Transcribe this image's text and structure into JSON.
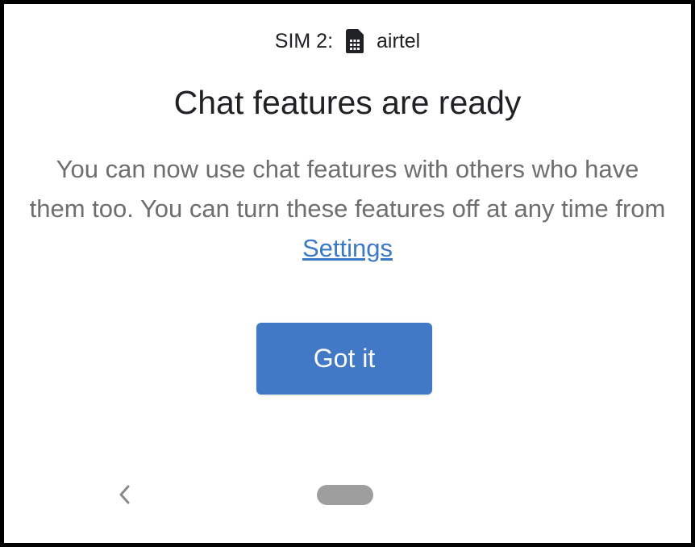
{
  "status": {
    "sim_label": "SIM 2:",
    "sim_icon": "sim-card-icon",
    "carrier": "airtel"
  },
  "dialog": {
    "title": "Chat features are ready",
    "body_text": "You can now use chat features with others who have them too. You can turn these features off at any time from ",
    "settings_link": "Settings",
    "button_label": "Got it"
  },
  "nav": {
    "back_icon": "back-chevron-icon",
    "home_icon": "home-pill-icon"
  },
  "colors": {
    "button": "#4179c7",
    "link": "#3b78c5",
    "title": "#202124",
    "body": "#6e6e6e"
  }
}
